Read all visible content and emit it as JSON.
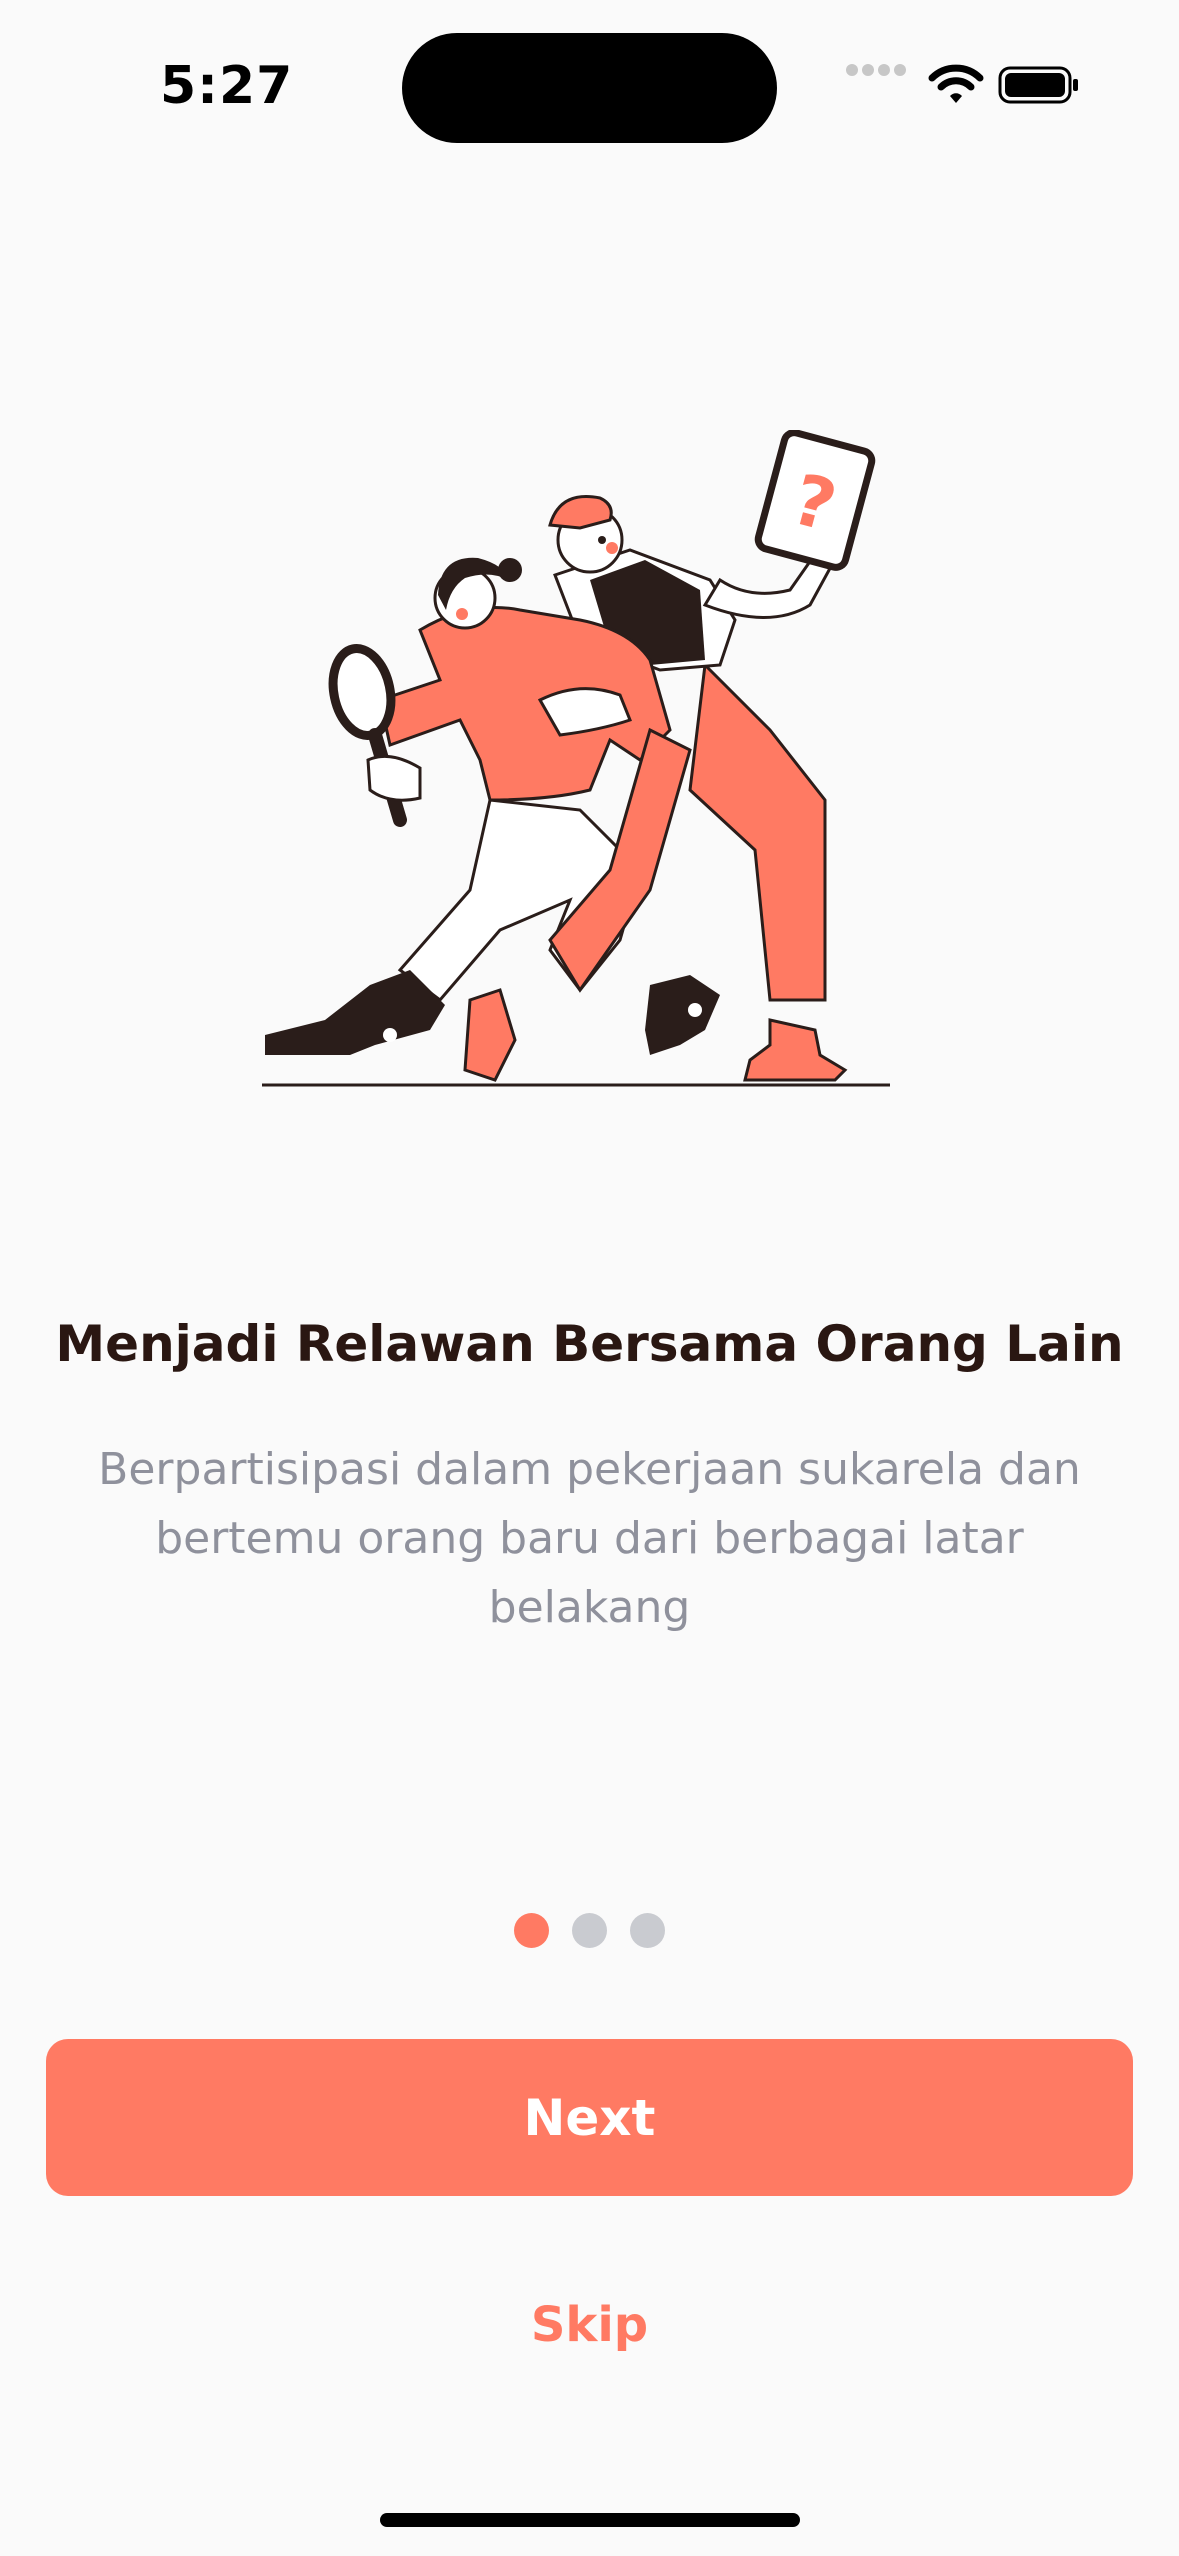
{
  "status_bar": {
    "time": "5:27",
    "icons": [
      "cellular-signal-icon",
      "wifi-icon",
      "battery-icon"
    ]
  },
  "onboarding": {
    "illustration": "volunteers-searching-illustration",
    "title": "Menjadi Relawan Bersama Orang Lain",
    "subtitle": "Berpartisipasi dalam pekerjaan sukarela dan bertemu orang baru dari berbagai latar belakang",
    "page_count": 3,
    "current_page": 1
  },
  "actions": {
    "next_label": "Next",
    "skip_label": "Skip"
  },
  "colors": {
    "accent": "#ff7a63",
    "title": "#2a1712",
    "subtitle": "#8f919c",
    "dot_inactive": "#c9cbd0",
    "background": "#fafafa"
  }
}
